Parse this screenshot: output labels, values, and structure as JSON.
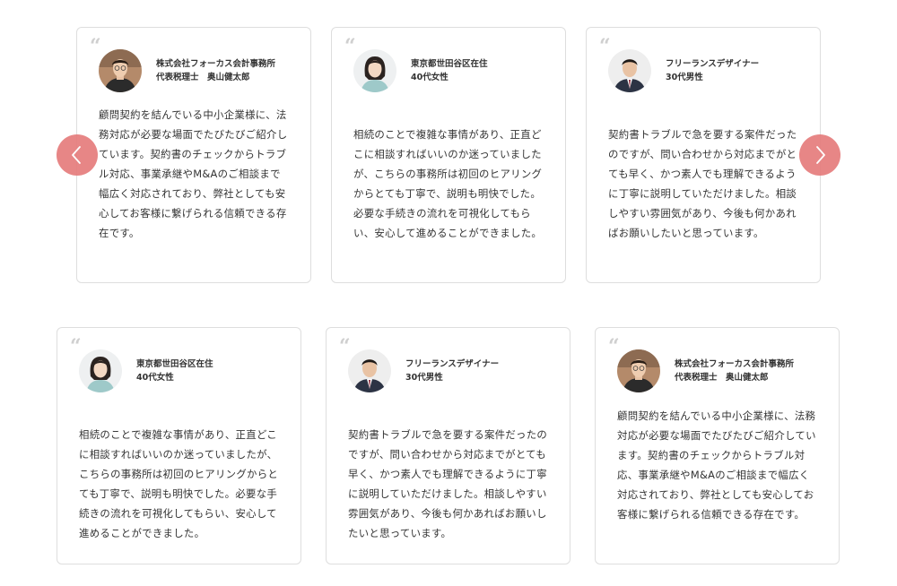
{
  "colors": {
    "accent": "#e57c7c",
    "card_border": "#dedede",
    "text": "#333333",
    "quote_mark": "#cfcfcf"
  },
  "carousel": {
    "prev_icon": "chevron-left-icon",
    "next_icon": "chevron-right-icon",
    "cards": [
      {
        "quote": "“",
        "avatar": "man-glasses-avatar",
        "org": "株式会社フォーカス会計事務所",
        "role": "代表税理士　奥山健太郎",
        "text": "顧問契約を結んでいる中小企業様に、法務対応が必要な場面でたびたびご紹介しています。契約書のチェックからトラブル対応、事業承継やM&Aのご相談まで幅広く対応されており、弊社としても安心してお客様に繋げられる信頼できる存在です。"
      },
      {
        "quote": "“",
        "avatar": "woman-avatar",
        "org": "東京都世田谷区在住",
        "role": "40代女性",
        "text": "相続のことで複雑な事情があり、正直どこに相談すればいいのか迷っていましたが、こちらの事務所は初回のヒアリングからとても丁寧で、説明も明快でした。必要な手続きの流れを可視化してもらい、安心して進めることができました。"
      },
      {
        "quote": "“",
        "avatar": "man-suit-avatar",
        "org": "フリーランスデザイナー",
        "role": "30代男性",
        "text": "契約書トラブルで急を要する案件だったのですが、問い合わせから対応までがとても早く、かつ素人でも理解できるように丁寧に説明していただけました。相談しやすい雰囲気があり、今後も何かあればお願いしたいと思っています。"
      }
    ]
  },
  "grid": {
    "cards": [
      {
        "quote": "“",
        "avatar": "woman-avatar",
        "org": "東京都世田谷区在住",
        "role": "40代女性",
        "text": "相続のことで複雑な事情があり、正直どこに相談すればいいのか迷っていましたが、こちらの事務所は初回のヒアリングからとても丁寧で、説明も明快でした。必要な手続きの流れを可視化してもらい、安心して進めることができました。"
      },
      {
        "quote": "“",
        "avatar": "man-suit-avatar",
        "org": "フリーランスデザイナー",
        "role": "30代男性",
        "text": "契約書トラブルで急を要する案件だったのですが、問い合わせから対応までがとても早く、かつ素人でも理解できるように丁寧に説明していただけました。相談しやすい雰囲気があり、今後も何かあればお願いしたいと思っています。"
      },
      {
        "quote": "“",
        "avatar": "man-glasses-avatar",
        "org": "株式会社フォーカス会計事務所",
        "role": "代表税理士　奥山健太郎",
        "text": "顧問契約を結んでいる中小企業様に、法務対応が必要な場面でたびたびご紹介しています。契約書のチェックからトラブル対応、事業承継やM&Aのご相談まで幅広く対応されており、弊社としても安心してお客様に繋げられる信頼できる存在です。"
      }
    ]
  }
}
